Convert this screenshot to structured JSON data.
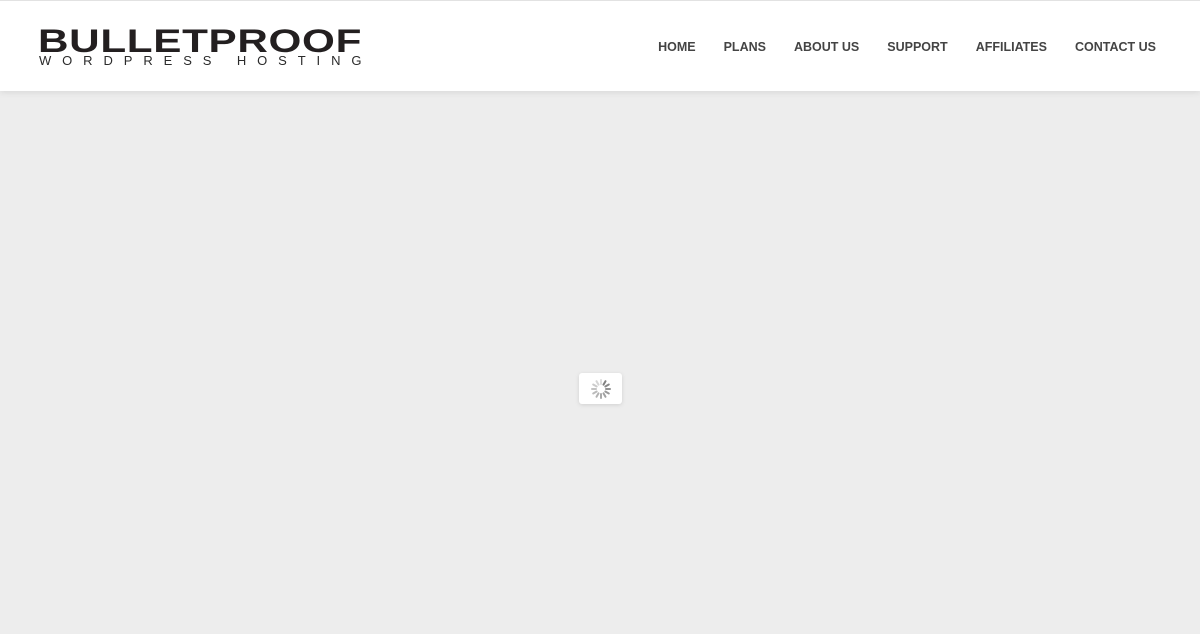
{
  "header": {
    "logo": {
      "main": "BULLETPROOF",
      "sub": "WORDPRESS HOSTING"
    },
    "nav": [
      {
        "label": "HOME"
      },
      {
        "label": "PLANS"
      },
      {
        "label": "ABOUT US"
      },
      {
        "label": "SUPPORT"
      },
      {
        "label": "AFFILIATES"
      },
      {
        "label": "CONTACT US"
      }
    ]
  },
  "loader": {
    "icon": "spinner-icon",
    "state": "loading"
  },
  "colors": {
    "header_bg": "#ffffff",
    "page_bg": "#ededed",
    "logo_text": "#231f20",
    "nav_text": "#444444"
  }
}
